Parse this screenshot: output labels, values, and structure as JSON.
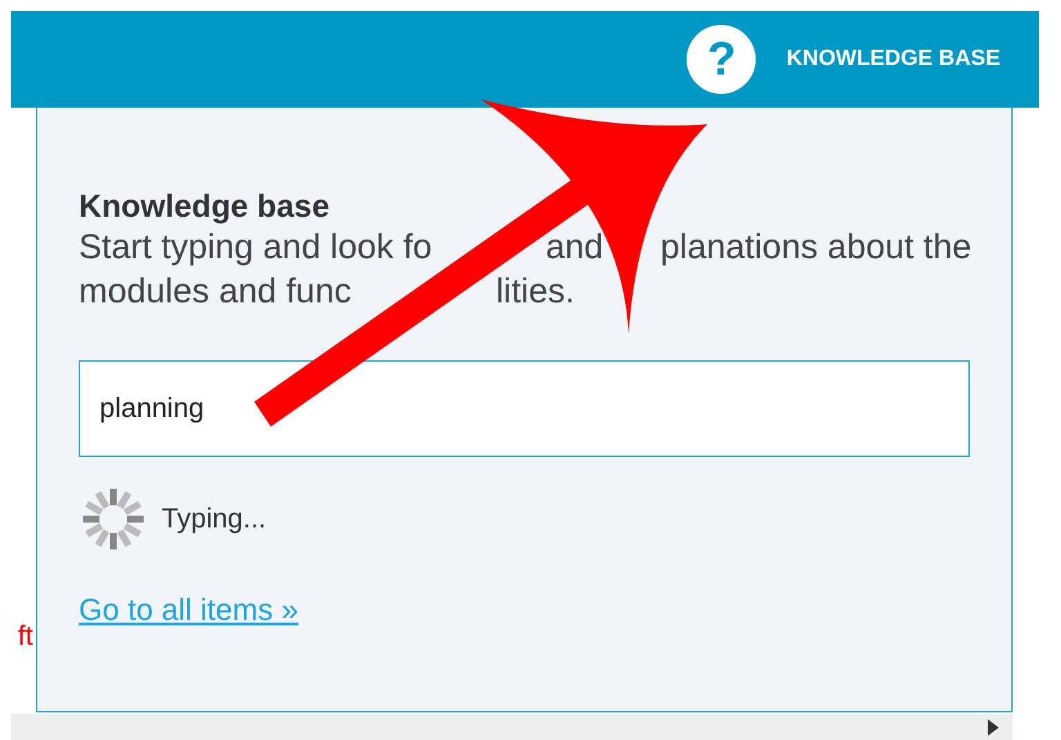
{
  "header": {
    "title": "KNOWLEDGE BASE",
    "help_icon": "?"
  },
  "panel": {
    "heading": "Knowledge base",
    "description_lines": [
      [
        "Start typing and look fo",
        "and",
        "planations about the"
      ],
      [
        "modules and func",
        "lities."
      ]
    ],
    "search": {
      "value": "planning"
    },
    "status": "Typing...",
    "link": "Go to all items »"
  },
  "background_text": "ft"
}
